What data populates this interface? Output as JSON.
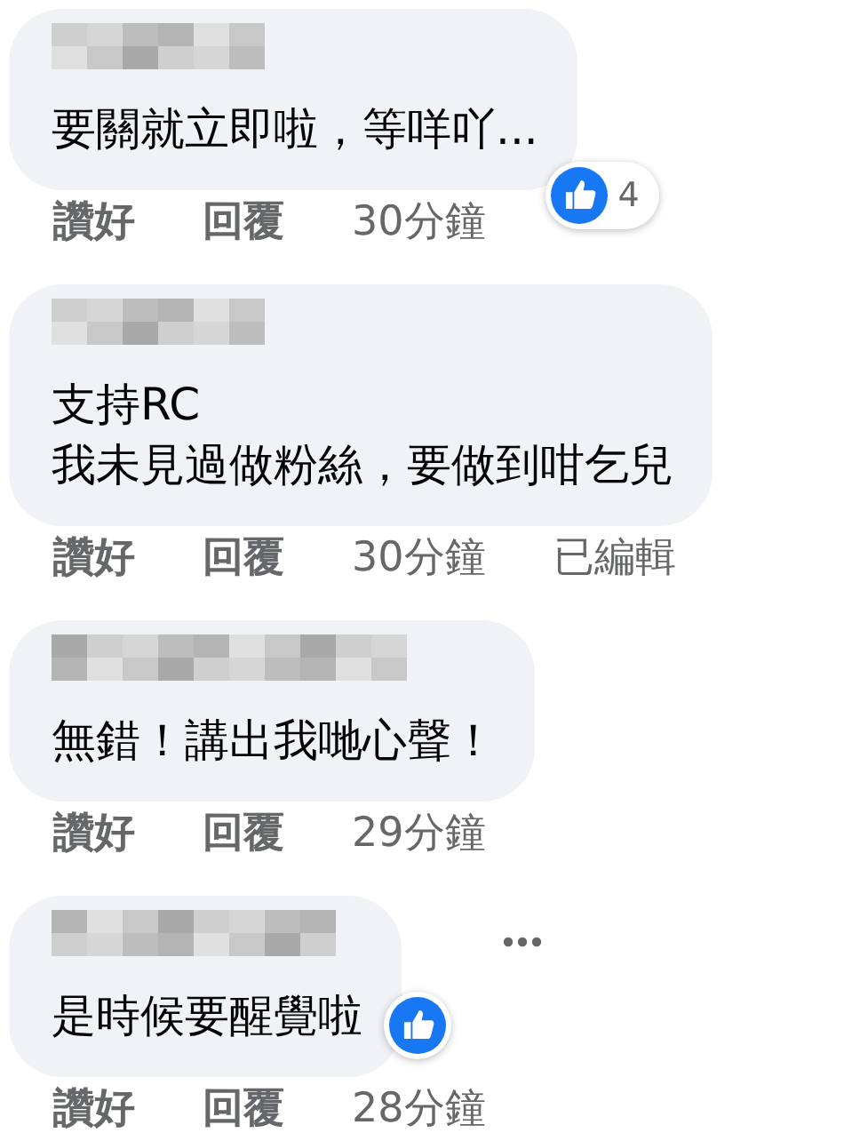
{
  "comments": [
    {
      "lines": [
        "要關就立即啦，等咩吖..."
      ],
      "actions": [
        "讚好",
        "回覆"
      ],
      "time": "30分鐘",
      "reaction": {
        "kind": "like",
        "count": "4"
      }
    },
    {
      "lines": [
        "支持RC",
        "我未見過做粉絲，要做到咁乞兒"
      ],
      "actions": [
        "讚好",
        "回覆"
      ],
      "time": "30分鐘",
      "edited": "已編輯"
    },
    {
      "lines": [
        "無錯！講出我哋心聲！"
      ],
      "actions": [
        "讚好",
        "回覆"
      ],
      "time": "29分鐘"
    },
    {
      "lines": [
        "是時候要醒覺啦"
      ],
      "actions": [
        "讚好",
        "回覆"
      ],
      "time": "28分鐘",
      "reaction": {
        "kind": "like"
      },
      "has_menu": true
    }
  ]
}
